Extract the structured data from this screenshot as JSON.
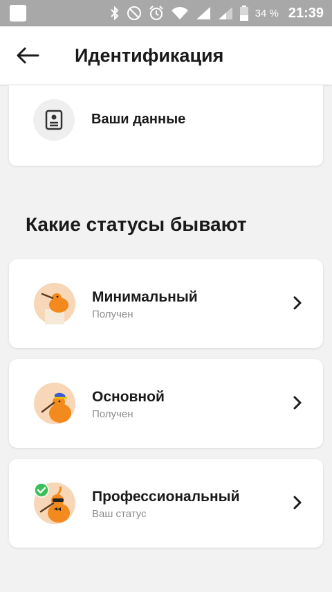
{
  "status_bar": {
    "battery_percent": "34 %",
    "time": "21:39",
    "icons": [
      "notification-square-icon",
      "bluetooth-icon",
      "do-not-disturb-icon",
      "alarm-icon",
      "wifi-icon",
      "signal-icon",
      "signal-icon",
      "battery-icon"
    ]
  },
  "app_bar": {
    "title": "Идентификация",
    "back_icon": "arrow-left-icon"
  },
  "data_card": {
    "label": "Ваши данные",
    "icon": "id-document-icon"
  },
  "section_title": "Какие статусы бывают",
  "statuses": [
    {
      "title": "Минимальный",
      "subtitle": "Получен",
      "avatar": "bird-minimal-avatar"
    },
    {
      "title": "Основной",
      "subtitle": "Получен",
      "avatar": "bird-basic-avatar"
    },
    {
      "title": "Профессиональный",
      "subtitle": "Ваш статус",
      "avatar": "bird-professional-avatar",
      "badge": "check-icon"
    }
  ],
  "colors": {
    "background": "#f2f2f2",
    "status_bar": "#a8a8a8",
    "accent_orange": "#f28a1e",
    "avatar_bg": "#f7d7b8",
    "check_green": "#3bbf5a"
  }
}
